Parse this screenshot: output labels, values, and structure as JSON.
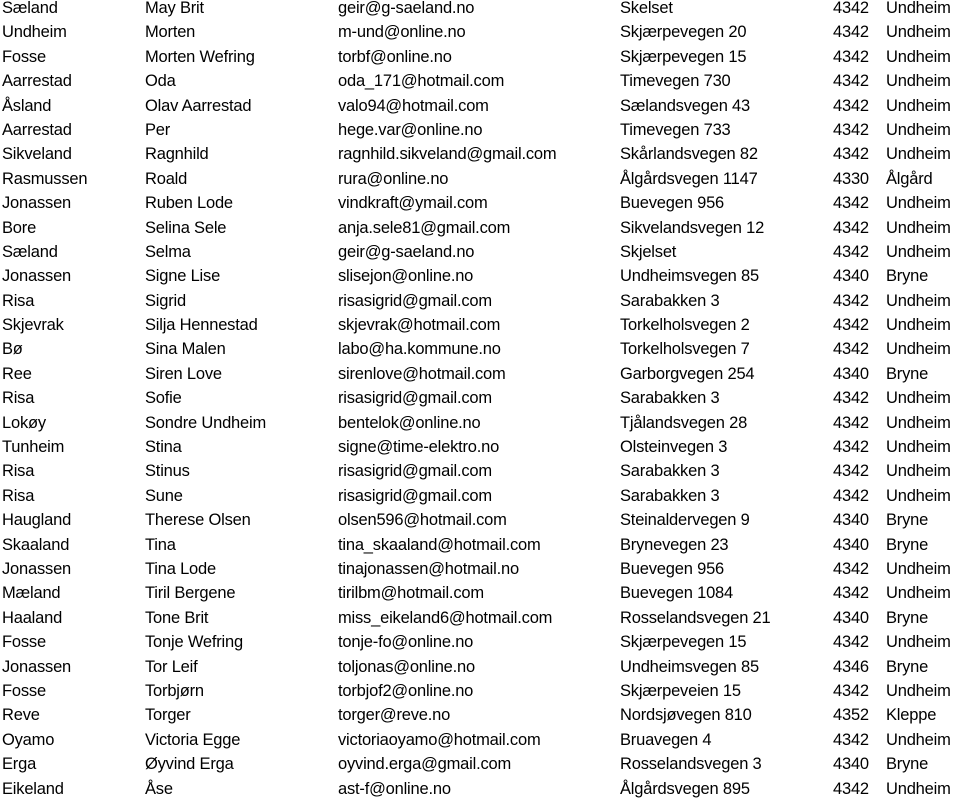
{
  "rows": [
    [
      "Sæland",
      "May Brit",
      "geir@g-saeland.no",
      "Skelset",
      "4342",
      "Undheim"
    ],
    [
      "Undheim",
      "Morten",
      "m-und@online.no",
      "Skjærpevegen 20",
      "4342",
      "Undheim"
    ],
    [
      "Fosse",
      "Morten Wefring",
      "torbf@online.no",
      "Skjærpevegen 15",
      "4342",
      "Undheim"
    ],
    [
      "Aarrestad",
      "Oda",
      "oda_171@hotmail.com",
      "Timevegen 730",
      "4342",
      "Undheim"
    ],
    [
      "Åsland",
      "Olav Aarrestad",
      "valo94@hotmail.com",
      "Sælandsvegen 43",
      "4342",
      "Undheim"
    ],
    [
      "Aarrestad",
      "Per",
      "hege.var@online.no",
      "Timevegen 733",
      "4342",
      "Undheim"
    ],
    [
      "Sikveland",
      "Ragnhild",
      "ragnhild.sikveland@gmail.com",
      "Skårlandsvegen 82",
      "4342",
      "Undheim"
    ],
    [
      "Rasmussen",
      "Roald",
      "rura@online.no",
      "Ålgårdsvegen 1147",
      "4330",
      "Ålgård"
    ],
    [
      "Jonassen",
      "Ruben Lode",
      "vindkraft@ymail.com",
      "Buevegen 956",
      "4342",
      "Undheim"
    ],
    [
      "Bore",
      "Selina Sele",
      "anja.sele81@gmail.com",
      "Sikvelandsvegen 12",
      "4342",
      "Undheim"
    ],
    [
      "Sæland",
      "Selma",
      "geir@g-saeland.no",
      "Skjelset",
      "4342",
      "Undheim"
    ],
    [
      "Jonassen",
      "Signe Lise",
      "slisejon@online.no",
      "Undheimsvegen 85",
      "4340",
      "Bryne"
    ],
    [
      "Risa",
      "Sigrid",
      "risasigrid@gmail.com",
      "Sarabakken 3",
      "4342",
      "Undheim"
    ],
    [
      "Skjevrak",
      "Silja Hennestad",
      "skjevrak@hotmail.com",
      "Torkelholsvegen 2",
      "4342",
      "Undheim"
    ],
    [
      "Bø",
      "Sina Malen",
      "labo@ha.kommune.no",
      "Torkelholsvegen 7",
      "4342",
      "Undheim"
    ],
    [
      "Ree",
      "Siren Love",
      "sirenlove@hotmail.com",
      "Garborgvegen 254",
      "4340",
      "Bryne"
    ],
    [
      "Risa",
      "Sofie",
      "risasigrid@gmail.com",
      "Sarabakken 3",
      "4342",
      "Undheim"
    ],
    [
      "Lokøy",
      "Sondre Undheim",
      "bentelok@online.no",
      "Tjålandsvegen 28",
      "4342",
      "Undheim"
    ],
    [
      "Tunheim",
      "Stina",
      "signe@time-elektro.no",
      "Olsteinvegen 3",
      "4342",
      "Undheim"
    ],
    [
      "Risa",
      "Stinus",
      "risasigrid@gmail.com",
      "Sarabakken 3",
      "4342",
      "Undheim"
    ],
    [
      "Risa",
      "Sune",
      "risasigrid@gmail.com",
      "Sarabakken 3",
      "4342",
      "Undheim"
    ],
    [
      "Haugland",
      "Therese Olsen",
      "olsen596@hotmail.com",
      "Steinaldervegen 9",
      "4340",
      "Bryne"
    ],
    [
      "Skaaland",
      "Tina",
      "tina_skaaland@hotmail.com",
      "Brynevegen 23",
      "4340",
      "Bryne"
    ],
    [
      "Jonassen",
      "Tina Lode",
      "tinajonassen@hotmail.no",
      "Buevegen 956",
      "4342",
      "Undheim"
    ],
    [
      "Mæland",
      "Tiril Bergene",
      "tirilbm@hotmail.com",
      "Buevegen 1084",
      "4342",
      "Undheim"
    ],
    [
      "Haaland",
      "Tone Brit",
      "miss_eikeland6@hotmail.com",
      "Rosselandsvegen 21",
      "4340",
      "Bryne"
    ],
    [
      "Fosse",
      "Tonje Wefring",
      "tonje-fo@online.no",
      "Skjærpevegen 15",
      "4342",
      "Undheim"
    ],
    [
      "Jonassen",
      "Tor Leif",
      "toljonas@online.no",
      "Undheimsvegen 85",
      "4346",
      "Bryne"
    ],
    [
      "Fosse",
      "Torbjørn",
      "torbjof2@online.no",
      "Skjærpeveien 15",
      "4342",
      "Undheim"
    ],
    [
      "Reve",
      "Torger",
      "torger@reve.no",
      "Nordsjøvegen 810",
      "4352",
      "Kleppe"
    ],
    [
      "Oyamo",
      "Victoria Egge",
      "victoriaoyamo@hotmail.com",
      "Bruavegen 4",
      "4342",
      "Undheim"
    ],
    [
      "Erga",
      "Øyvind Erga",
      "oyvind.erga@gmail.com",
      "Rosselandsvegen 3",
      "4340",
      "Bryne"
    ],
    [
      "Eikeland",
      "Åse",
      "ast-f@online.no",
      "Ålgårdsvegen 895",
      "4342",
      "Undheim"
    ]
  ]
}
